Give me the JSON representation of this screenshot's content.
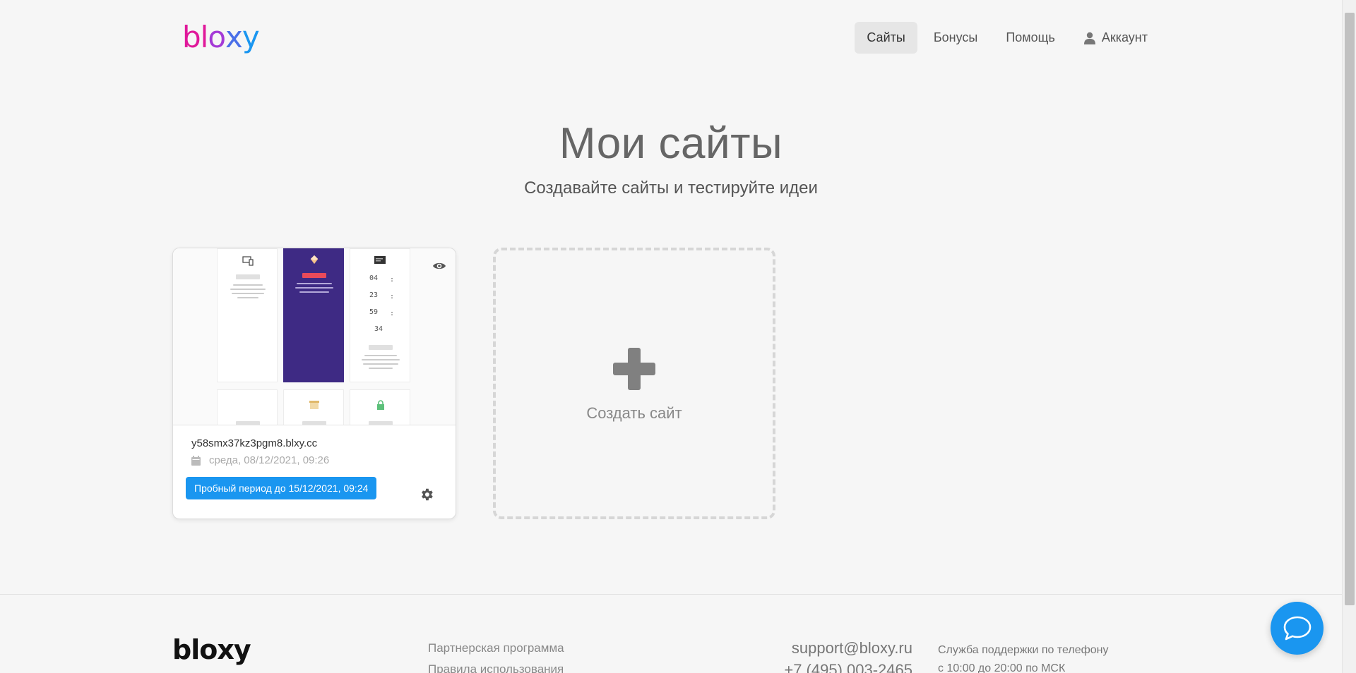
{
  "header": {
    "logo_letters": [
      {
        "char": "b",
        "color": "#e0189a"
      },
      {
        "char": "l",
        "color": "#e0189a"
      },
      {
        "char": "o",
        "color": "#a43ad6"
      },
      {
        "char": "x",
        "color": "#4a6fe8"
      },
      {
        "char": "y",
        "color": "#1a96f0"
      }
    ],
    "nav": [
      {
        "label": "Сайты",
        "active": true
      },
      {
        "label": "Бонусы",
        "active": false
      },
      {
        "label": "Помощь",
        "active": false
      },
      {
        "label": "Аккаунт",
        "active": false,
        "icon": "user-icon"
      }
    ]
  },
  "hero": {
    "title": "Мои сайты",
    "subtitle": "Создавайте сайты и тестируйте идеи"
  },
  "site_card": {
    "domain": "y58smx37kz3pgm8.blxy.cc",
    "date": "среда, 08/12/2021, 09:26",
    "trial_badge": "Пробный период до 15/12/2021, 09:24",
    "countdown": [
      "04",
      "23",
      "59",
      "34"
    ]
  },
  "create_card": {
    "label": "Создать сайт"
  },
  "footer": {
    "logo": "bloxy",
    "links": [
      "Партнерская программа",
      "Правила использования"
    ],
    "email": "support@bloxy.ru",
    "phone": "+7 (495) 003-2465",
    "support_label": "Служба поддержки по телефону",
    "support_hours": "с 10:00 до 20:00 по МСК"
  },
  "colors": {
    "accent": "#1a96f0",
    "preview_purple": "#3e2a84",
    "background": "#f6f6f6"
  }
}
